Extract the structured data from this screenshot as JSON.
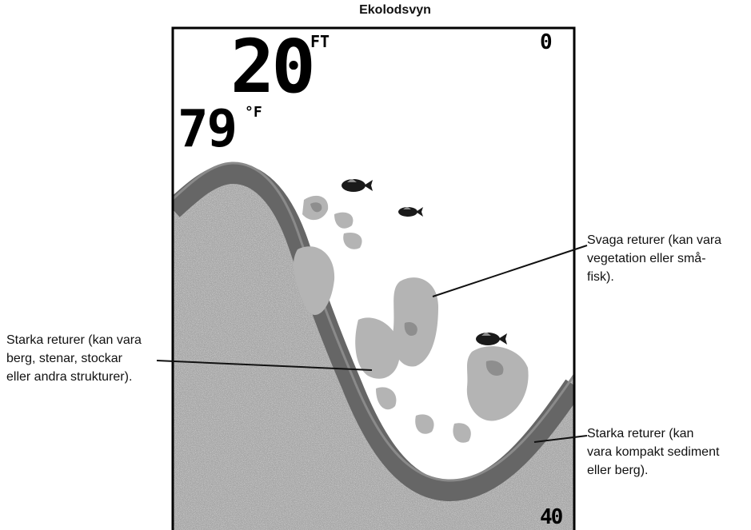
{
  "title": "Ekolodsvyn",
  "readouts": {
    "depth_value": "20",
    "depth_unit": "FT",
    "temperature_value": "79",
    "temperature_unit": "°F",
    "scale_top": "0",
    "scale_bottom": "40"
  },
  "callouts": {
    "weak_returns": "Svaga returer (kan vara\nvegetation eller små-\nfisk).",
    "strong_returns_structure": "Starka returer (kan vara\nberg, stenar, stockar\neller andra strukturer).",
    "strong_returns_bottom": "Starka returer (kan\nvara kompakt sediment\neller berg)."
  },
  "colors": {
    "screen_background": "#ffffff",
    "bottom_fill": "#a6a6a6",
    "bottom_band": "#666666",
    "weak_return": "#b4b4b4",
    "fish": "#1a1a1a",
    "frame": "#000000"
  },
  "icons": [
    "fish-icon",
    "fish-icon",
    "fish-icon"
  ]
}
